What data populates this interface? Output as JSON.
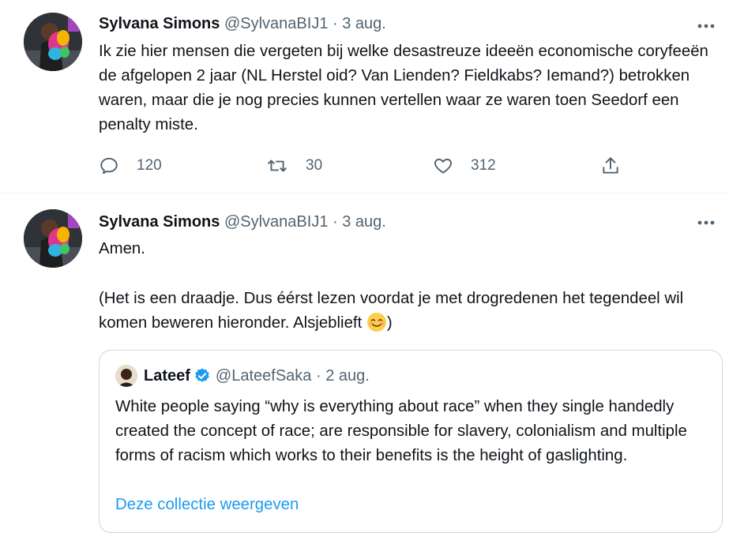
{
  "tweets": [
    {
      "author_name": "Sylvana Simons",
      "handle": "@SylvanaBIJ1",
      "separator": "·",
      "time": "3 aug.",
      "text": "Ik zie hier mensen die vergeten bij welke desastreuze ideeën economische coryfeeën de afgelopen 2 jaar (NL Herstel oid? Van Lienden? Fieldkabs? Iemand?) betrokken waren, maar die je nog precies kunnen vertellen waar ze waren toen Seedorf een penalty miste.",
      "reply_count": "120",
      "retweet_count": "30",
      "like_count": "312"
    },
    {
      "author_name": "Sylvana Simons",
      "handle": "@SylvanaBIJ1",
      "separator": "·",
      "time": "3 aug.",
      "text_line1": "Amen.",
      "text_line2": "(Het is een draadje. Dus éérst lezen voordat je met drogredenen het tegendeel wil komen beweren hieronder. Alsjeblieft",
      "text_line2_end": ")",
      "quoted": {
        "author_name": "Lateef",
        "handle": "@LateefSaka",
        "separator": "·",
        "time": "2 aug.",
        "text": "White people saying “why is everything about race” when they single handedly created the concept of race; are responsible for slavery, colonialism and multiple forms of racism which works to their benefits is the height of gaslighting.",
        "link": "Deze collectie weergeven"
      }
    }
  ],
  "icons": {
    "more": "more-dots-icon",
    "reply": "reply-icon",
    "retweet": "retweet-icon",
    "like": "heart-icon",
    "share": "share-icon",
    "verified": "verified-badge-icon",
    "emoji": "smiling-face-emoji"
  },
  "colors": {
    "text": "#0f1419",
    "muted": "#536471",
    "link": "#1d9bf0",
    "border": "#cfd9de"
  }
}
